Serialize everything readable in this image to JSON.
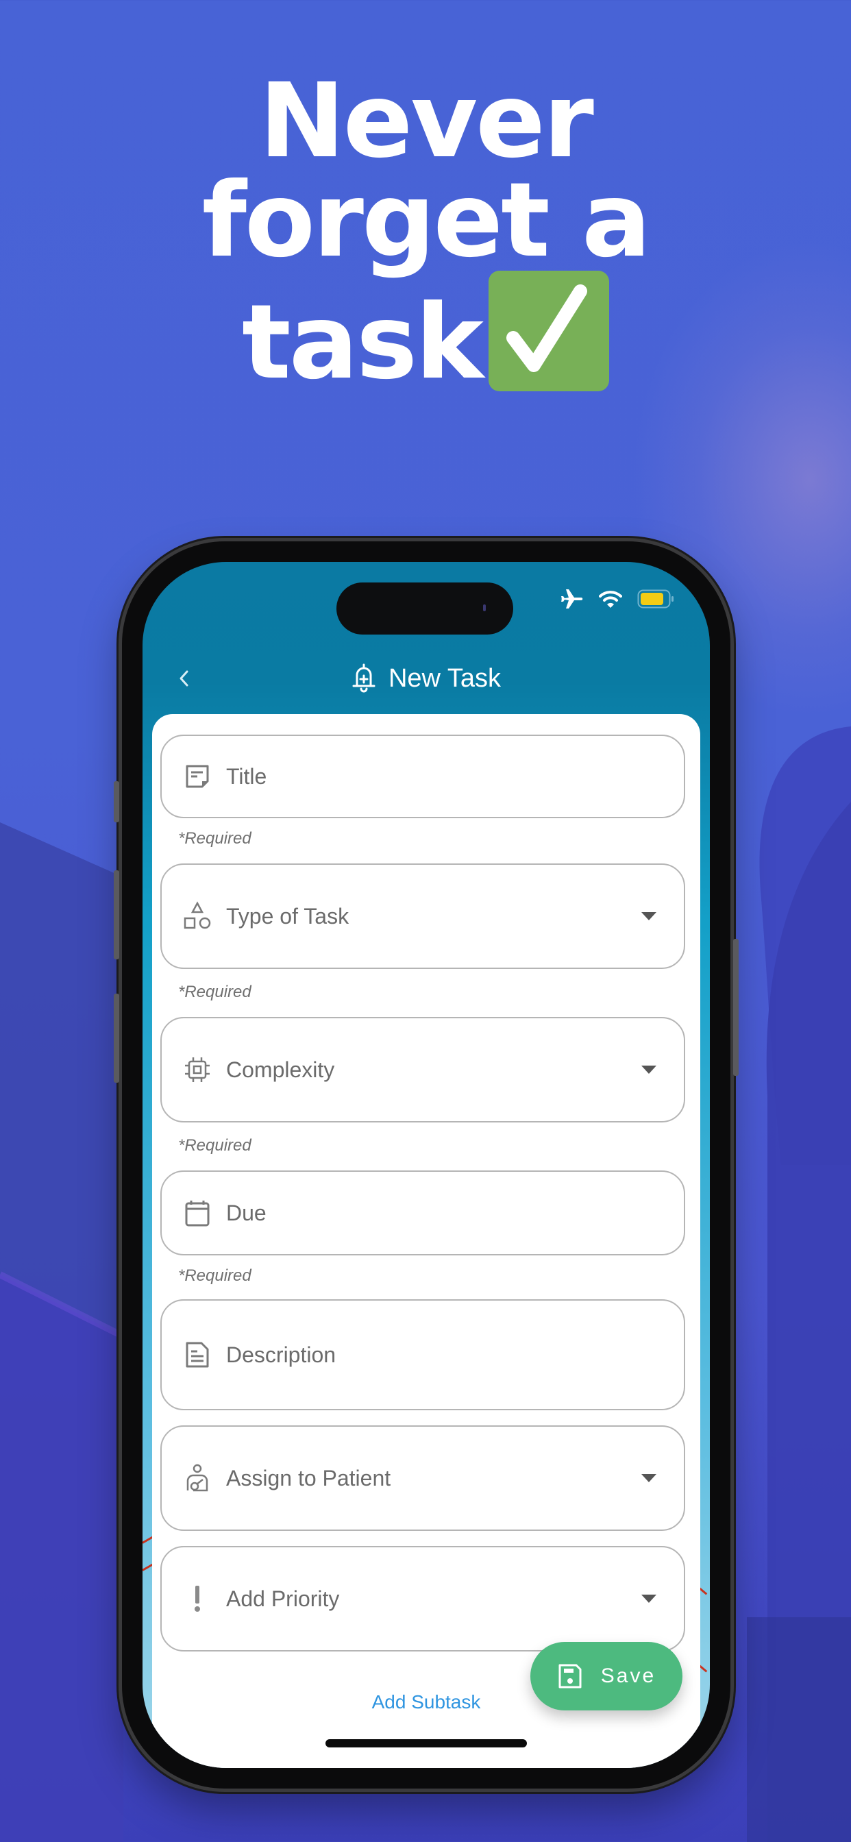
{
  "headline": {
    "lines": [
      "Never",
      "forget a",
      "task"
    ],
    "emoji_icon": "check-mark-button-icon"
  },
  "colors": {
    "background": "#4a62d6",
    "headline_text": "#ffffff",
    "checkbox_green": "#78b057",
    "appbar": "#0b7aa3",
    "save_button": "#4dba7f",
    "add_subtask_link": "#2f95e0",
    "battery_fill": "#f4cc14"
  },
  "status_bar": {
    "icons": [
      "airplane-icon",
      "wifi-icon",
      "battery-icon"
    ]
  },
  "appbar": {
    "back_icon": "chevron-left-icon",
    "title_icon": "bell-plus-icon",
    "title": "New Task"
  },
  "form": {
    "fields": [
      {
        "label": "Title",
        "icon": "note-icon",
        "dropdown": false,
        "required_hint": "*Required"
      },
      {
        "label": "Type of Task",
        "icon": "shapes-icon",
        "dropdown": true,
        "required_hint": "*Required"
      },
      {
        "label": "Complexity",
        "icon": "chip-icon",
        "dropdown": true,
        "required_hint": "*Required"
      },
      {
        "label": "Due",
        "icon": "calendar-icon",
        "dropdown": false,
        "required_hint": "*Required"
      },
      {
        "label": "Description",
        "icon": "document-icon",
        "dropdown": false
      },
      {
        "label": "Assign to Patient",
        "icon": "patient-icon",
        "dropdown": true
      },
      {
        "label": "Add Priority",
        "icon": "exclamation-icon",
        "dropdown": true
      }
    ],
    "add_subtask": "Add Subtask",
    "save_label": "Save",
    "save_icon": "floppy-disk-icon"
  }
}
